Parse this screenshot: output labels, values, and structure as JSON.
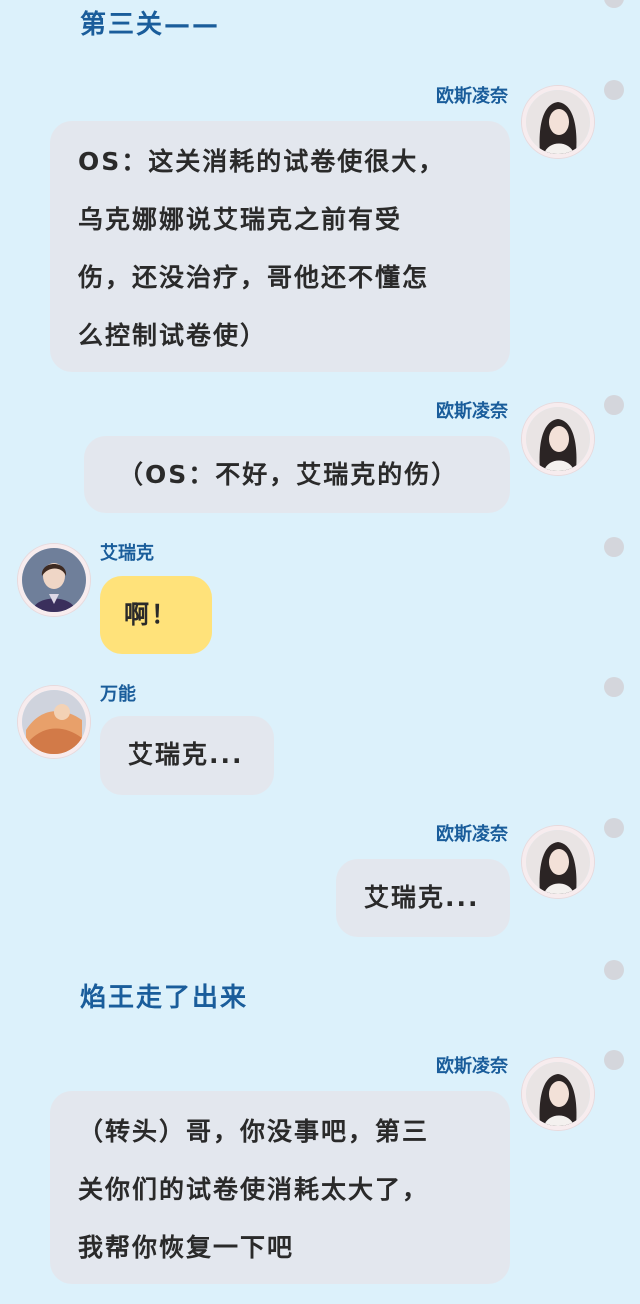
{
  "narration": [
    "第三关——",
    "焰王走了出来"
  ],
  "characters": {
    "ousi": {
      "name": "欧斯凌奈",
      "avatar_icon": "girl-portrait-avatar-icon"
    },
    "airuike": {
      "name": "艾瑞克",
      "avatar_icon": "boy-portrait-avatar-icon"
    },
    "wanneng": {
      "name": "万能",
      "avatar_icon": "abstract-orange-avatar-icon"
    }
  },
  "messages": [
    {
      "speaker": "欧斯凌奈",
      "side": "right",
      "lines": [
        "OS：这关消耗的试卷使很大，",
        "乌克娜娜说艾瑞克之前有受",
        "伤，还没治疗，哥他还不懂怎",
        "么控制试卷使）"
      ]
    },
    {
      "speaker": "欧斯凌奈",
      "side": "right",
      "lines": [
        "（OS：不好，艾瑞克的伤）"
      ]
    },
    {
      "speaker": "艾瑞克",
      "side": "left",
      "lines": [
        "啊！"
      ]
    },
    {
      "speaker": "万能",
      "side": "left",
      "lines": [
        "艾瑞克..."
      ]
    },
    {
      "speaker": "欧斯凌奈",
      "side": "right",
      "lines": [
        "艾瑞克..."
      ]
    },
    {
      "speaker": "欧斯凌奈",
      "side": "right",
      "lines": [
        "（转头）哥，你没事吧，第三",
        "关你们的试卷使消耗太大了，",
        "我帮你恢复一下吧"
      ]
    }
  ],
  "colors": {
    "background": "#dcf1fb",
    "name": "#1a5d9b",
    "bubble_gray": "#e3e7ee",
    "bubble_yellow": "#ffe27a",
    "dot": "#d4d6dc"
  }
}
